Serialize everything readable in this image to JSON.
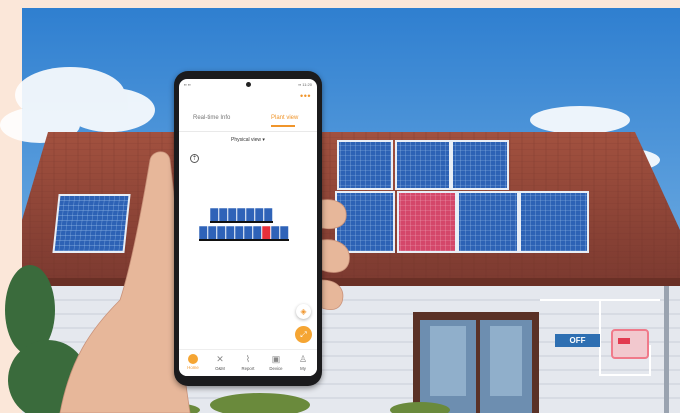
{
  "app": {
    "status_left": "▪▪ ▪▪",
    "status_right": "▪▪ 11:20",
    "more_icon": "more-icon",
    "tabs": [
      "Real-time Info",
      "Plant view"
    ],
    "active_tab": "Plant view",
    "view_select": "Physical view ▾",
    "nav": [
      {
        "label": "Home",
        "icon": "home-icon",
        "active": true
      },
      {
        "label": "O&M",
        "icon": "tools-icon",
        "active": false
      },
      {
        "label": "Report",
        "icon": "chart-icon",
        "active": false
      },
      {
        "label": "Device",
        "icon": "device-icon",
        "active": false
      },
      {
        "label": "My",
        "icon": "user-icon",
        "active": false
      }
    ]
  },
  "scene": {
    "switch_label": "OFF"
  },
  "colors": {
    "accent": "#f0952b",
    "panel_normal": "#2f63b8",
    "panel_fault": "#e8303a",
    "roof": "#9a4a3e",
    "sky": "#3f8fd6",
    "wall": "#e7eaef"
  }
}
